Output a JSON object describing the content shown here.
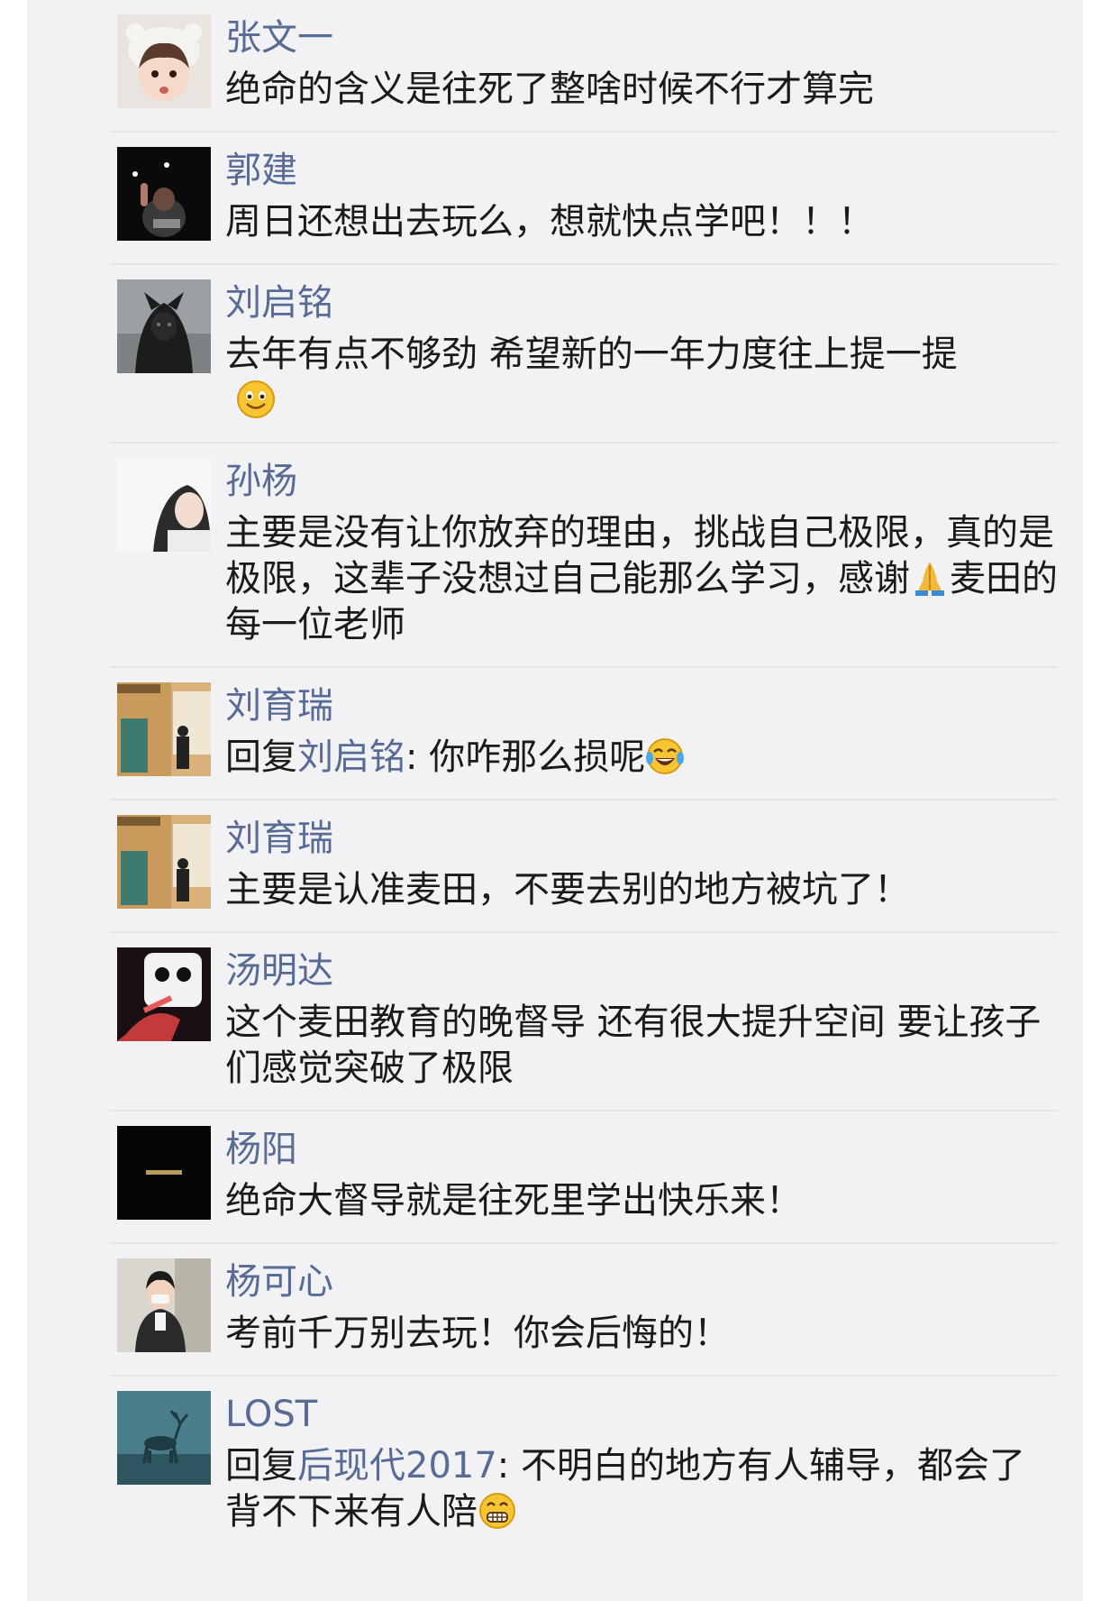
{
  "comments": [
    {
      "name": "张文一",
      "text": "绝命的含义是往死了整啥时候不行才算完"
    },
    {
      "name": "郭建",
      "text": "周日还想出去玩么，想就快点学吧！！！"
    },
    {
      "name": "刘启铭",
      "text": "去年有点不够劲  希望新的一年力度往上提一提",
      "emoji": "smile-emoji"
    },
    {
      "name": "孙杨",
      "text_a": "主要是没有让你放弃的理由，挑战自己极限，真的是极限，这辈子没想过自己能那么学习，感谢",
      "emoji": "pray-emoji",
      "text_b": "麦田的每一位老师"
    },
    {
      "name": "刘育瑞",
      "reply_prefix": "回复",
      "reply_to": "刘启铭",
      "text": ": 你咋那么损呢",
      "emoji": "tears-of-joy-emoji"
    },
    {
      "name": "刘育瑞",
      "text": "主要是认准麦田，不要去别的地方被坑了！"
    },
    {
      "name": "汤明达",
      "text": "这个麦田教育的晚督导 还有很大提升空间 要让孩子们感觉突破了极限"
    },
    {
      "name": "杨阳",
      "text": "绝命大督导就是往死里学出快乐来！"
    },
    {
      "name": "杨可心",
      "text": "考前千万别去玩！你会后悔的！"
    },
    {
      "name": "LOST",
      "reply_prefix": "回复",
      "reply_to": "后现代2017",
      "text": ": 不明白的地方有人辅导，都会了背不下来有人陪",
      "emoji": "grin-emoji"
    }
  ],
  "avatar_image": "photo-avatar"
}
